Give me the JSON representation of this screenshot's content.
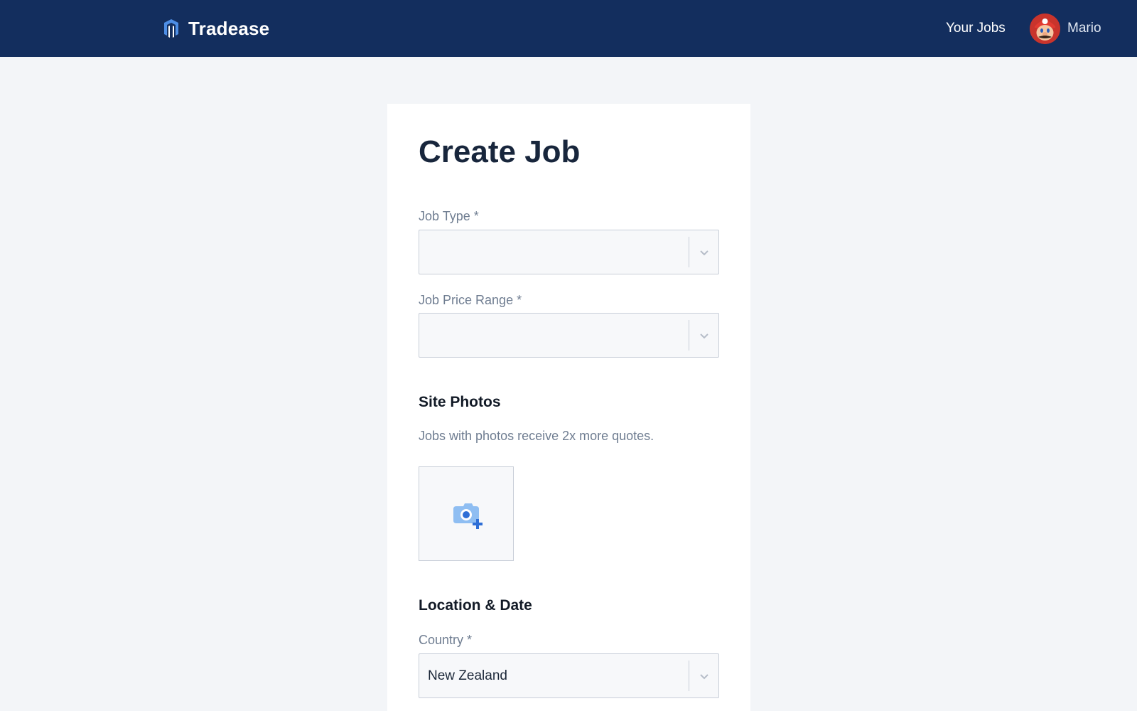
{
  "app": {
    "name": "Tradease"
  },
  "nav": {
    "your_jobs_label": "Your Jobs",
    "user_name": "Mario"
  },
  "form": {
    "title": "Create Job",
    "job_type": {
      "label": "Job Type *",
      "value": ""
    },
    "job_price_range": {
      "label": "Job Price Range *",
      "value": ""
    },
    "site_photos": {
      "title": "Site Photos",
      "hint": "Jobs with photos receive 2x more quotes."
    },
    "location_date": {
      "title": "Location & Date",
      "country": {
        "label": "Country *",
        "value": "New Zealand"
      }
    }
  },
  "icons": {
    "brand": "tradease-logo-icon",
    "dropdown": "chevron-down-icon",
    "add_photo": "camera-add-icon",
    "avatar": "mario-avatar"
  },
  "colors": {
    "navbar": "#132e5e",
    "page_background": "#f3f5f8",
    "card": "#ffffff",
    "accent": "#2f6fd6",
    "icon_light": "#8fbef2"
  }
}
